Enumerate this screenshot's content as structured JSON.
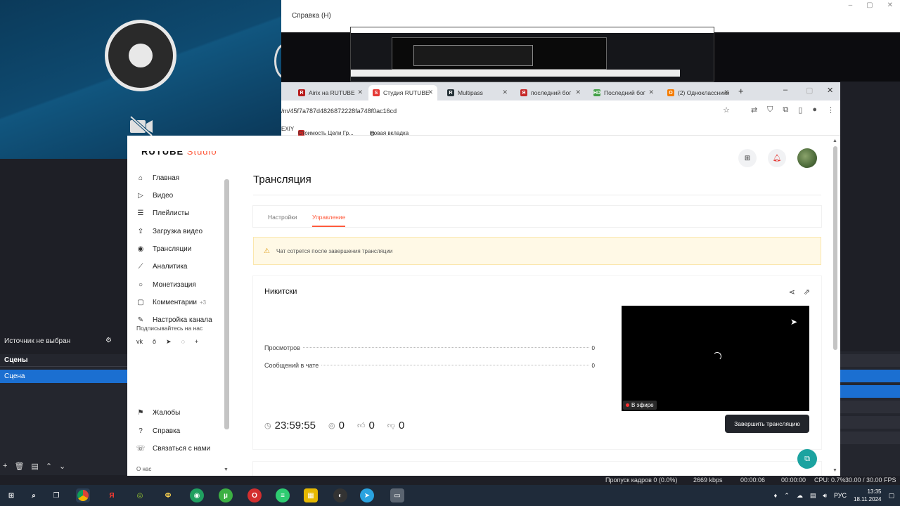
{
  "obs": {
    "menu_help": "Справка (H)",
    "source_none": "Источник не выбран",
    "scenes_header": "Сцены",
    "scene_item": "Сцена",
    "status": {
      "dropped": "Пропуск кадров 0 (0.0%)",
      "bitrate": "2669 kbps",
      "stream_time": "00:00:06",
      "rec_time": "00:00:00",
      "cpu": "CPU: 0.7%",
      "fps": "30.00 / 30.00 FPS"
    }
  },
  "browser": {
    "tabs": [
      {
        "label": "Airix на RUTUBE",
        "color": "#b71c1c",
        "glyph": "R"
      },
      {
        "label": "Студия RUTUBE",
        "color": "#e53935",
        "glyph": "S",
        "active": true
      },
      {
        "label": "Multipass",
        "color": "#263238",
        "glyph": "R"
      },
      {
        "label": "последний бог",
        "color": "#c62828",
        "glyph": "Я"
      },
      {
        "label": "Последний бог",
        "color": "#43a047",
        "glyph": "HD"
      },
      {
        "label": "(2) Одноклассники",
        "color": "#f57c00",
        "glyph": "О"
      }
    ],
    "url": "/m/45f7a787d4826872228fa748f0ac16cd",
    "bookmarks": [
      {
        "label": "EXIY"
      },
      {
        "label": "Стоимость Цели Гр..."
      },
      {
        "label": "Новая вкладка"
      }
    ]
  },
  "studio": {
    "brand": "RUTUBE",
    "brand_suffix": "Studio",
    "nav": [
      {
        "label": "Главная",
        "icon": "home-icon",
        "glyph": "⌂"
      },
      {
        "label": "Видео",
        "icon": "video-icon",
        "glyph": "▷"
      },
      {
        "label": "Плейлисты",
        "icon": "playlist-icon",
        "glyph": "☰"
      },
      {
        "label": "Загрузка видео",
        "icon": "upload-icon",
        "glyph": "⇪"
      },
      {
        "label": "Трансляции",
        "icon": "broadcast-icon",
        "glyph": "◉"
      },
      {
        "label": "Аналитика",
        "icon": "analytics-icon",
        "glyph": "⟋"
      },
      {
        "label": "Монетизация",
        "icon": "monetization-icon",
        "glyph": "○"
      },
      {
        "label": "Комментарии",
        "icon": "comments-icon",
        "glyph": "▢",
        "badge": "+3"
      },
      {
        "label": "Настройка канала",
        "icon": "channel-settings-icon",
        "glyph": "✎"
      }
    ],
    "subscribe_label": "Подписывайтесь на нас",
    "socials": [
      "vk",
      "ok",
      "telegram",
      "whatsapp",
      "more"
    ],
    "nav_bottom": [
      {
        "label": "Жалобы",
        "icon": "flag-icon",
        "glyph": "⚑"
      },
      {
        "label": "Справка",
        "icon": "help-icon",
        "glyph": "?"
      },
      {
        "label": "Связаться с нами",
        "icon": "contact-icon",
        "glyph": "☏"
      }
    ],
    "about": "О нас",
    "page_title": "Трансляция",
    "tabs": [
      {
        "label": "Настройки"
      },
      {
        "label": "Управление",
        "active": true
      }
    ],
    "notice": "Чат сотрется после завершения трансляции",
    "stream_name": "Никитски",
    "stats": [
      {
        "label": "Просмотров",
        "value": "0"
      },
      {
        "label": "Сообщений в чате",
        "value": "0"
      }
    ],
    "live_badge": "В эфире",
    "duration": "23:59:55",
    "viewers": "0",
    "likes": "0",
    "dislikes": "0",
    "end_button": "Завершить трансляцию"
  },
  "taskbar": {
    "time": "13:35",
    "date": "18.11.2024",
    "lang": "РУС"
  }
}
